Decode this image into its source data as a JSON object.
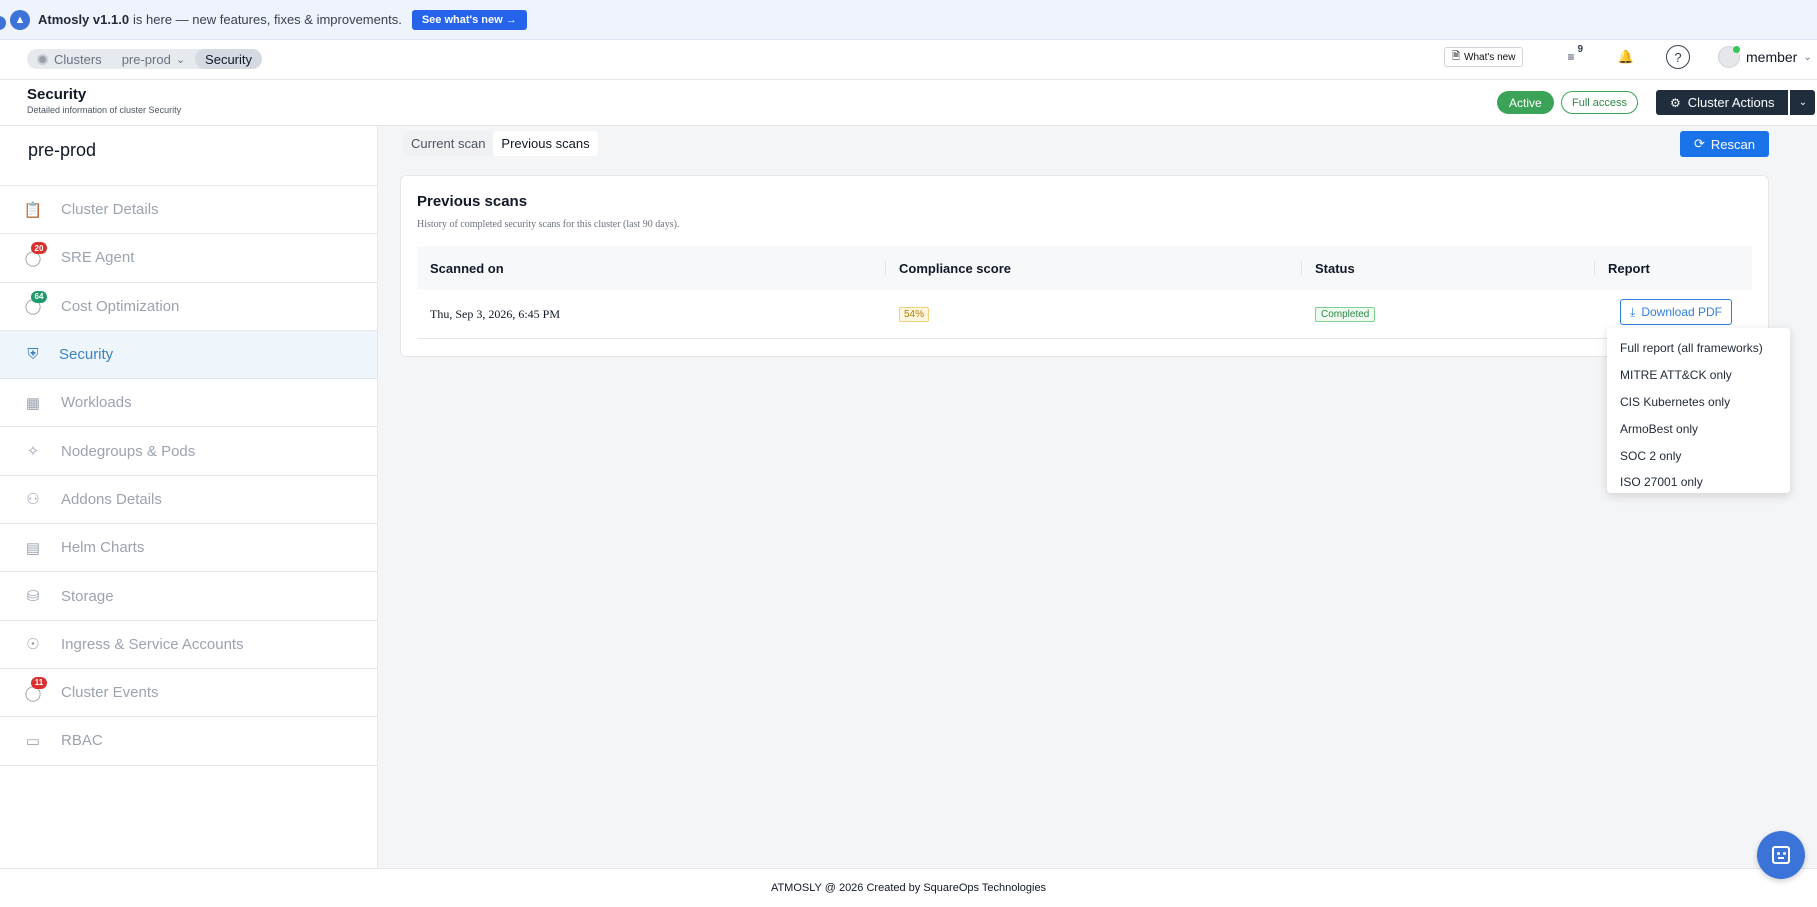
{
  "banner": {
    "version": "Atmosly v1.1.0",
    "message": "is here — new features, fixes & improvements.",
    "cta": "See what's new →"
  },
  "topnav": {
    "breadcrumbs": [
      "Clusters",
      "pre-prod",
      "Security"
    ],
    "whats_new": "What's new",
    "notification_count": "9",
    "user": "member"
  },
  "header": {
    "title": "Security",
    "subtitle": "Detailed information of cluster Security",
    "status": "Active",
    "access": "Full access",
    "actions_label": "Cluster Actions"
  },
  "sidebar": {
    "cluster_name": "pre-prod",
    "items": [
      {
        "label": "Cluster Details",
        "icon": "clipboard-icon",
        "badge": ""
      },
      {
        "label": "SRE Agent",
        "icon": "agent-icon",
        "badge": "20"
      },
      {
        "label": "Cost Optimization",
        "icon": "cost-icon",
        "badge": "64"
      },
      {
        "label": "Security",
        "icon": "shield-icon",
        "badge": ""
      },
      {
        "label": "Workloads",
        "icon": "grid-icon",
        "badge": ""
      },
      {
        "label": "Nodegroups & Pods",
        "icon": "nodes-icon",
        "badge": ""
      },
      {
        "label": "Addons Details",
        "icon": "puzzle-icon",
        "badge": ""
      },
      {
        "label": "Helm Charts",
        "icon": "store-icon",
        "badge": ""
      },
      {
        "label": "Storage",
        "icon": "database-icon",
        "badge": ""
      },
      {
        "label": "Ingress & Service Accounts",
        "icon": "globe-icon",
        "badge": ""
      },
      {
        "label": "Cluster Events",
        "icon": "events-icon",
        "badge": "11"
      },
      {
        "label": "RBAC",
        "icon": "id-card-icon",
        "badge": ""
      }
    ]
  },
  "main": {
    "tabs": [
      "Current scan",
      "Previous scans"
    ],
    "rescan": "Rescan",
    "card": {
      "title": "Previous scans",
      "description": "History of completed security scans for this cluster (last 90 days).",
      "columns": [
        "Scanned on",
        "Compliance score",
        "Status",
        "Report"
      ],
      "rows": [
        {
          "scanned_on": "Thu, Sep 3, 2026, 6:45 PM",
          "score": "54%",
          "status": "Completed",
          "report": "Download PDF"
        }
      ]
    },
    "report_menu": [
      "Full report (all frameworks)",
      "MITRE ATT&CK only",
      "CIS Kubernetes only",
      "ArmoBest only",
      "SOC 2 only",
      "ISO 27001 only"
    ]
  },
  "footer": {
    "text": "ATMOSLY @ 2026 Created by SquareOps Technologies"
  },
  "colors": {
    "accent": "#1a73e8",
    "active_green": "#3aa357",
    "banner_bg": "#eef3fc",
    "sidebar_active": "#3b82c4"
  }
}
